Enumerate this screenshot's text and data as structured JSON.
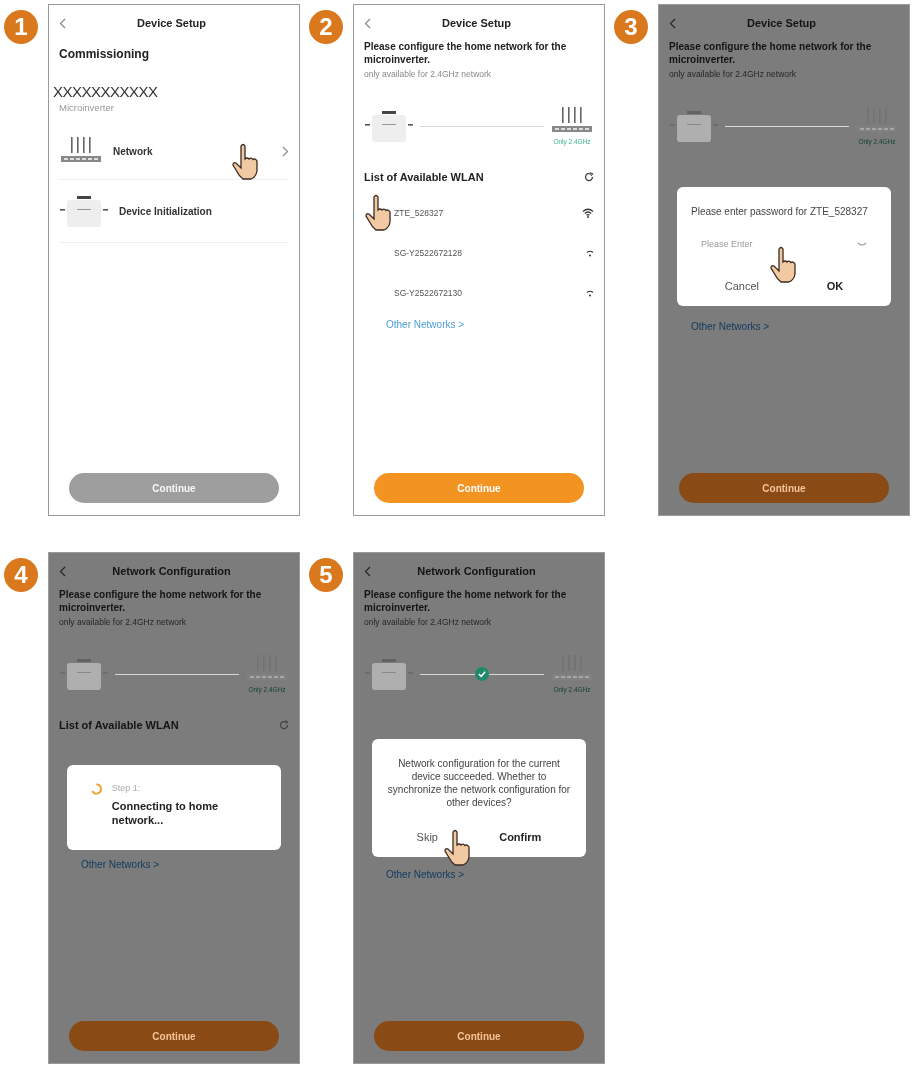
{
  "screens": [
    {
      "step": "1",
      "kind": "commissioning",
      "title": "Device Setup",
      "dimmed": false,
      "heading": "Commissioning",
      "device_id": "XXXXXXXXXXX",
      "device_type": "Microinverter",
      "items": [
        {
          "label": "Network",
          "kind": "router",
          "chevron": true,
          "tapped": true
        },
        {
          "label": "Device Initialization",
          "kind": "inverter",
          "chevron": false,
          "tapped": false
        }
      ],
      "continue": {
        "label": "Continue",
        "enabled": false
      }
    },
    {
      "step": "2",
      "kind": "wlan",
      "title": "Device Setup",
      "dimmed": false,
      "prompt": "Please configure the home network for the microinverter.",
      "note": "only available for 2.4GHz network",
      "router_caption": "Only 2.4GHz",
      "connected": false,
      "wlan_heading": "List of Available WLAN",
      "networks": [
        {
          "name": "ZTE_528327",
          "kind": "strong",
          "tapped": true
        },
        {
          "name": "SG-Y2522672128",
          "kind": "weak",
          "tapped": false
        },
        {
          "name": "SG-Y2522672130",
          "kind": "weak",
          "tapped": false
        }
      ],
      "other_networks": "Other Networks >",
      "continue": {
        "label": "Continue",
        "enabled": true
      }
    },
    {
      "step": "3",
      "kind": "wlan",
      "title": "Device Setup",
      "dimmed": true,
      "prompt": "Please configure the home network for the microinverter.",
      "note": "only available for 2.4GHz network",
      "router_caption": "Only 2.4GHz",
      "connected": false,
      "other_networks": "Other Networks >",
      "continue": {
        "label": "Continue",
        "enabled": true
      },
      "dialog": {
        "kind": "password",
        "message": "Please enter password for ZTE_528327",
        "placeholder": "Please Enter",
        "field_tapped": true,
        "buttons": [
          {
            "label": "Cancel",
            "primary": false,
            "tapped": false
          },
          {
            "label": "OK",
            "primary": true,
            "tapped": false
          }
        ]
      }
    },
    {
      "step": "4",
      "kind": "wlan",
      "title": "Network Configuration",
      "dimmed": true,
      "prompt": "Please configure the home network for the microinverter.",
      "note": "only available for 2.4GHz network",
      "router_caption": "Only 2.4GHz",
      "connected": false,
      "wlan_heading": "List of Available WLAN",
      "other_networks": "Other Networks >",
      "continue": {
        "label": "Continue",
        "enabled": true
      },
      "dialog": {
        "kind": "progress",
        "label": "Step 1:",
        "message": "Connecting to home network..."
      }
    },
    {
      "step": "5",
      "kind": "wlan",
      "title": "Network Configuration",
      "dimmed": true,
      "prompt": "Please configure the home network for the microinverter.",
      "note": "only available for 2.4GHz network",
      "router_caption": "Only 2.4GHz",
      "connected": true,
      "other_networks": "Other Networks >",
      "continue": {
        "label": "Continue",
        "enabled": true
      },
      "dialog": {
        "kind": "confirm",
        "message": "Network configuration for the current device succeeded. Whether to synchronize the network configuration for other devices?",
        "buttons": [
          {
            "label": "Skip",
            "primary": false,
            "tapped": true
          },
          {
            "label": "Confirm",
            "primary": true,
            "tapped": false
          }
        ]
      }
    }
  ]
}
